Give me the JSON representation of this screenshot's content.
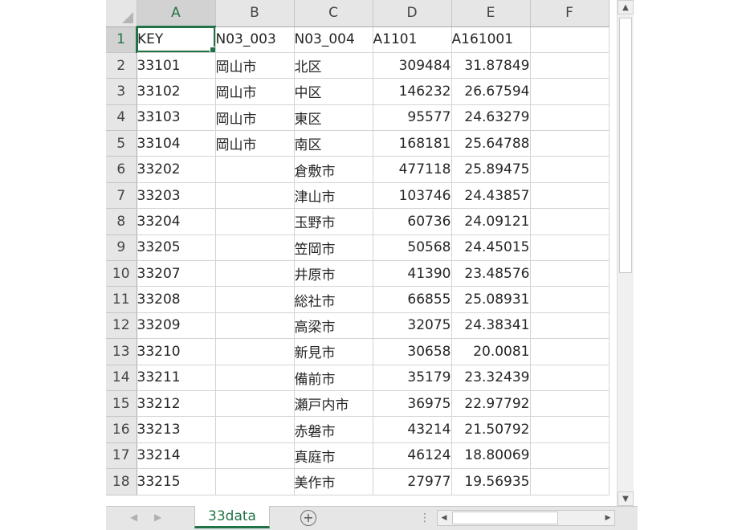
{
  "columns": [
    "A",
    "B",
    "C",
    "D",
    "E",
    "F"
  ],
  "active_column": "A",
  "active_row": "1",
  "rows": [
    {
      "n": "1",
      "a": "KEY",
      "b": "N03_003",
      "c": "N03_004",
      "d": "A1101",
      "e": "A161001"
    },
    {
      "n": "2",
      "a": "33101",
      "b": "岡山市",
      "c": "北区",
      "d": "309484",
      "e": "31.87849"
    },
    {
      "n": "3",
      "a": "33102",
      "b": "岡山市",
      "c": "中区",
      "d": "146232",
      "e": "26.67594"
    },
    {
      "n": "4",
      "a": "33103",
      "b": "岡山市",
      "c": "東区",
      "d": "95577",
      "e": "24.63279"
    },
    {
      "n": "5",
      "a": "33104",
      "b": "岡山市",
      "c": "南区",
      "d": "168181",
      "e": "25.64788"
    },
    {
      "n": "6",
      "a": "33202",
      "b": "",
      "c": "倉敷市",
      "d": "477118",
      "e": "25.89475"
    },
    {
      "n": "7",
      "a": "33203",
      "b": "",
      "c": "津山市",
      "d": "103746",
      "e": "24.43857"
    },
    {
      "n": "8",
      "a": "33204",
      "b": "",
      "c": "玉野市",
      "d": "60736",
      "e": "24.09121"
    },
    {
      "n": "9",
      "a": "33205",
      "b": "",
      "c": "笠岡市",
      "d": "50568",
      "e": "24.45015"
    },
    {
      "n": "10",
      "a": "33207",
      "b": "",
      "c": "井原市",
      "d": "41390",
      "e": "23.48576"
    },
    {
      "n": "11",
      "a": "33208",
      "b": "",
      "c": "総社市",
      "d": "66855",
      "e": "25.08931"
    },
    {
      "n": "12",
      "a": "33209",
      "b": "",
      "c": "高梁市",
      "d": "32075",
      "e": "24.38341"
    },
    {
      "n": "13",
      "a": "33210",
      "b": "",
      "c": "新見市",
      "d": "30658",
      "e": "20.0081"
    },
    {
      "n": "14",
      "a": "33211",
      "b": "",
      "c": "備前市",
      "d": "35179",
      "e": "23.32439"
    },
    {
      "n": "15",
      "a": "33212",
      "b": "",
      "c": "瀬戸内市",
      "d": "36975",
      "e": "22.97792"
    },
    {
      "n": "16",
      "a": "33213",
      "b": "",
      "c": "赤磐市",
      "d": "43214",
      "e": "21.50792"
    },
    {
      "n": "17",
      "a": "33214",
      "b": "",
      "c": "真庭市",
      "d": "46124",
      "e": "18.80069"
    },
    {
      "n": "18",
      "a": "33215",
      "b": "",
      "c": "美作市",
      "d": "27977",
      "e": "19.56935"
    }
  ],
  "sheet_tab": {
    "label": "33data"
  },
  "icons": {
    "add_sheet": "plus-circle-icon",
    "scroll_up": "triangle-up-icon",
    "scroll_down": "triangle-down-icon",
    "scroll_left": "triangle-left-icon",
    "scroll_right": "triangle-right-icon"
  },
  "colors": {
    "accent": "#217346",
    "header_bg": "#e6e6e6",
    "gridline": "#d4d4d4"
  }
}
